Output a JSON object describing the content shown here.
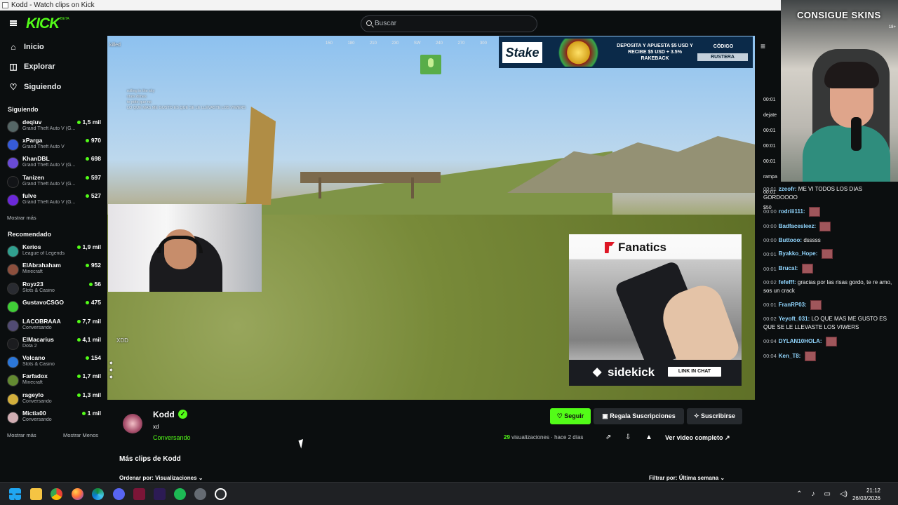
{
  "window": {
    "title": "Kodd - Watch clips on Kick"
  },
  "header": {
    "brand": "KICK",
    "beta": "BETA",
    "search_placeholder": "Buscar"
  },
  "sidebar": {
    "nav": [
      {
        "label": "Inicio",
        "icon": "home-icon"
      },
      {
        "label": "Explorar",
        "icon": "compass-icon"
      },
      {
        "label": "Siguiendo",
        "icon": "heart-icon"
      }
    ],
    "following_title": "Siguiendo",
    "following": [
      {
        "name": "deqiuv",
        "game": "Grand Theft Auto V (G...",
        "viewers": "1,5 mil"
      },
      {
        "name": "xParga",
        "game": "Grand Theft Auto V",
        "viewers": "970"
      },
      {
        "name": "KhanDBL",
        "game": "Grand Theft Auto V (G...",
        "viewers": "698"
      },
      {
        "name": "Tanizen",
        "game": "Grand Theft Auto V (G...",
        "viewers": "597"
      },
      {
        "name": "fulve",
        "game": "Grand Theft Auto V (G...",
        "viewers": "527"
      }
    ],
    "show_more": "Mostrar más",
    "recommended_title": "Recomendado",
    "recommended": [
      {
        "name": "Kerios",
        "game": "League of Legends",
        "viewers": "1,9 mil"
      },
      {
        "name": "ElAbrahaham",
        "game": "Minecraft",
        "viewers": "952"
      },
      {
        "name": "Royz23",
        "game": "Slots & Casino",
        "viewers": "56"
      },
      {
        "name": "GustavoCSGO",
        "game": "",
        "viewers": "475"
      },
      {
        "name": "LACOBRAAA",
        "game": "Conversando",
        "viewers": "7,7 mil"
      },
      {
        "name": "ElMacarius",
        "game": "Dota 2",
        "viewers": "4,1 mil"
      },
      {
        "name": "Volcano",
        "game": "Slots & Casino",
        "viewers": "154"
      },
      {
        "name": "Farfadox",
        "game": "Minecraft",
        "viewers": "1,7 mil"
      },
      {
        "name": "rageylo",
        "game": "Conversando",
        "viewers": "1,3 mil"
      },
      {
        "name": "Mictia00",
        "game": "Conversando",
        "viewers": "1 mil"
      }
    ],
    "show_more_2": "Mostrar más",
    "show_less": "Mostrar Menos"
  },
  "video": {
    "kill_feed": "killed",
    "compass": [
      "150",
      "180",
      "210",
      "230",
      "SW",
      "240",
      "270",
      "300"
    ],
    "chat_messages": [
      "rolling in the sky",
      "stats dimes",
      "te pide que no",
      "LO QUE MAS ME GUSTO ES QUE SE LE LLEVASTE LOS VIWERS"
    ],
    "xdd": "XDD",
    "ads": {
      "stake_logo": "Stake",
      "stake_text": "DEPOSITA Y APUESTA $5 USD Y RECIBE $5 USD + 3.5% RAKEBACK",
      "promo_label": "CÓDIGO",
      "promo_code": "RUSTERA",
      "fanatics_brand": "Fanatics",
      "sidekick_brand": "sidekick",
      "sidekick_cta": "LINK IN CHAT"
    }
  },
  "right_panel": {
    "overlay_text": "CONSIGUE SKINS",
    "overlay_age": "18+",
    "partial_messages": [
      "00:01",
      "dejate",
      "00:01",
      "00:01",
      "00:01",
      "rampa",
      "00:01",
      "$50"
    ],
    "chat": [
      {
        "time": "00:01",
        "user": "zzeofr:",
        "text": "ME VI TODOS LOS DIAS GORDOOOO",
        "emote": false
      },
      {
        "time": "00:00",
        "user": "rodriii111:",
        "text": "",
        "emote": true
      },
      {
        "time": "00:00",
        "user": "Badfacesleez:",
        "text": "",
        "emote": true
      },
      {
        "time": "00:00",
        "user": "Buttooo:",
        "text": "dsssss",
        "emote": false
      },
      {
        "time": "00:01",
        "user": "Byakko_Hope:",
        "text": "",
        "emote": true
      },
      {
        "time": "00:01",
        "user": "Brucal:",
        "text": "",
        "emote": true
      },
      {
        "time": "00:02",
        "user": "fefefff:",
        "text": "gracias por las risas gordo, te re amo, sos un crack",
        "emote": false
      },
      {
        "time": "00:01",
        "user": "FranRP03:",
        "text": "",
        "emote": true
      },
      {
        "time": "00:02",
        "user": "Yeyoft_031:",
        "text": "LO QUE MAS ME GUSTO ES QUE SE LE LLEVASTE LOS VIWERS",
        "emote": false
      },
      {
        "time": "00:04",
        "user": "DYLAN10HOLA:",
        "text": "",
        "emote": true
      },
      {
        "time": "00:04",
        "user": "Ken_T8:",
        "text": "",
        "emote": true
      }
    ]
  },
  "clip": {
    "streamer": "Kodd",
    "title": "xd",
    "category": "Conversando",
    "follow": "Seguir",
    "gift_subs": "Regala Suscripciones",
    "subscribe": "Suscribirse",
    "views": "29",
    "views_label": "visualizaciones",
    "age": "hace 2 días",
    "full_video": "Ver video completo",
    "more_clips": "Más clips de Kodd",
    "sort_label": "Ordenar por:",
    "sort_value": "Visualizaciones",
    "filter_label": "Filtrar por:",
    "filter_value": "Última semana"
  },
  "taskbar": {
    "time": "21:12",
    "date": "26/03/2026"
  }
}
